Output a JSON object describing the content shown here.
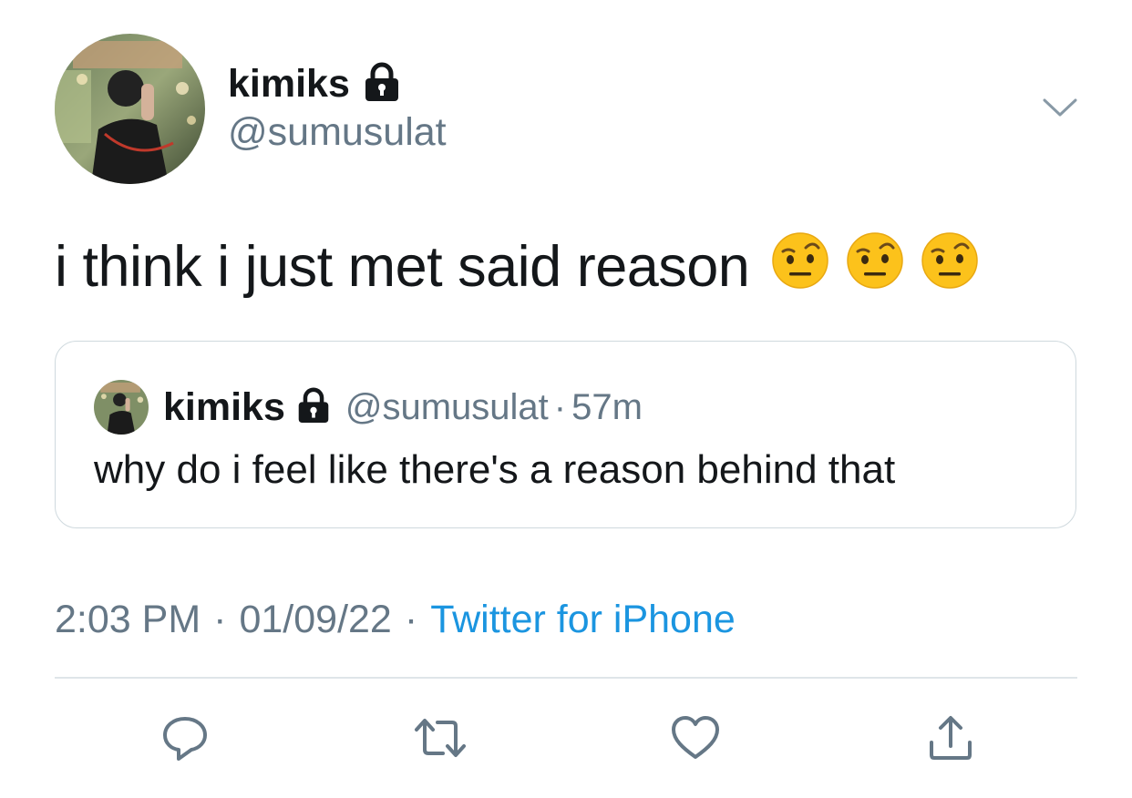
{
  "tweet": {
    "author": {
      "display_name": "kimiks",
      "handle": "@sumusulat",
      "protected_icon": "lock-icon",
      "avatar": "profile-photo"
    },
    "text": "i think i just met said reason",
    "emojis": [
      "face-with-raised-eyebrow",
      "face-with-raised-eyebrow",
      "face-with-raised-eyebrow"
    ],
    "quoted": {
      "display_name": "kimiks",
      "handle": "@sumusulat",
      "separator": "·",
      "time": "57m",
      "text": "why do i feel like there's a reason behind that"
    },
    "meta": {
      "time": "2:03 PM",
      "separator": "·",
      "date": "01/09/22",
      "source": "Twitter for iPhone"
    },
    "more_icon": "chevron-down-icon"
  },
  "actions": [
    {
      "name": "reply",
      "icon": "reply-icon"
    },
    {
      "name": "retweet",
      "icon": "retweet-icon"
    },
    {
      "name": "like",
      "icon": "heart-icon"
    },
    {
      "name": "share",
      "icon": "share-icon"
    }
  ],
  "colors": {
    "text_primary": "#14171a",
    "text_secondary": "#657786",
    "link": "#1b95e0",
    "border": "#cfd9de",
    "icon": "#657786"
  }
}
